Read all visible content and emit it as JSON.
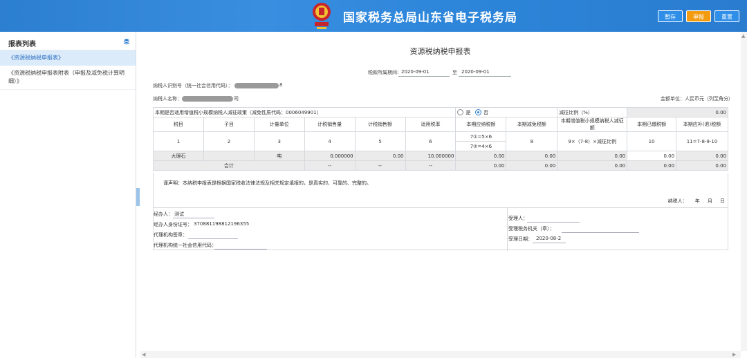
{
  "header": {
    "title": "国家税务总局山东省电子税务局",
    "btn_save": "暂存",
    "btn_submit": "申报",
    "btn_reset": "重置",
    "accent": "#2c7fd0",
    "submit_color": "#f39c12"
  },
  "sidebar": {
    "title": "报表列表",
    "items": [
      {
        "label": "《资源税纳税申报表》"
      },
      {
        "label": "《资源税纳税申报表附表（申报及减免税计算明细）》"
      }
    ]
  },
  "form": {
    "title": "资源税纳税申报表",
    "period_label": "税款所属期间:",
    "period_from": "2020-09-01",
    "period_to_label": "至",
    "period_to": "2020-09-01",
    "taxpayer_id_label": "纳税人识别号（统一社会信用代码）：",
    "taxpayer_id_tail": "8",
    "taxpayer_name_label": "纳税人名称：",
    "taxpayer_name_tail": "司",
    "unit": "金额单位：人民币元（列至角分）"
  },
  "table": {
    "policy_question": "本期是否适用增值税小规模纳税人减征政策（减免性质代码：0006049901）",
    "yes": "是",
    "no": "否",
    "reduction_ratio_label": "减征比例（%）",
    "reduction_ratio_value": "0.00",
    "headers": [
      "税目",
      "子目",
      "计量单位",
      "计税销售量",
      "计税销售额",
      "适用税率",
      "本期应纳税额",
      "本期减免税额",
      "本期增值税小规模纳税人减征额",
      "本期已缴税额",
      "本期应补(退)税额"
    ],
    "col_nums": [
      "1",
      "2",
      "3",
      "4",
      "5",
      "6",
      "",
      "8",
      "9×（7-8）×减征比例",
      "10",
      "11=7-8-9-10"
    ],
    "formula_a": "7①=5×6",
    "formula_b": "7②=4×6",
    "row1": [
      "大理石",
      "",
      "吨",
      "0.000000",
      "0.00",
      "10.000000",
      "0.00",
      "0.00",
      "0.00",
      "0.00",
      "0.00"
    ],
    "total_label": "合计",
    "total_row": [
      "--",
      "--",
      "--",
      "--",
      "0.00",
      "0.00",
      "0.00",
      "0.00",
      "0.00"
    ]
  },
  "declaration": {
    "text": "谨声明：本纳税申报表是根据国家税收法律法规及相关规定填报的，是真实的、可靠的、完整的。",
    "signer": "纳税人：",
    "year": "年",
    "month": "月",
    "day": "日"
  },
  "bottom": {
    "agent_label": "经办人：",
    "agent_value": "测试",
    "agent_id_label": "经办人身份证号：",
    "agent_id_value": "370881198812196355",
    "agency_seal_label": "代理机构签章：",
    "agency_code_label": "代理机构统一社会信用代码：",
    "receiver_label": "受理人：",
    "tax_office_label": "受理税务机关（章）：",
    "accept_date_label": "受理日期：",
    "accept_date_value": "2020-08-2"
  }
}
